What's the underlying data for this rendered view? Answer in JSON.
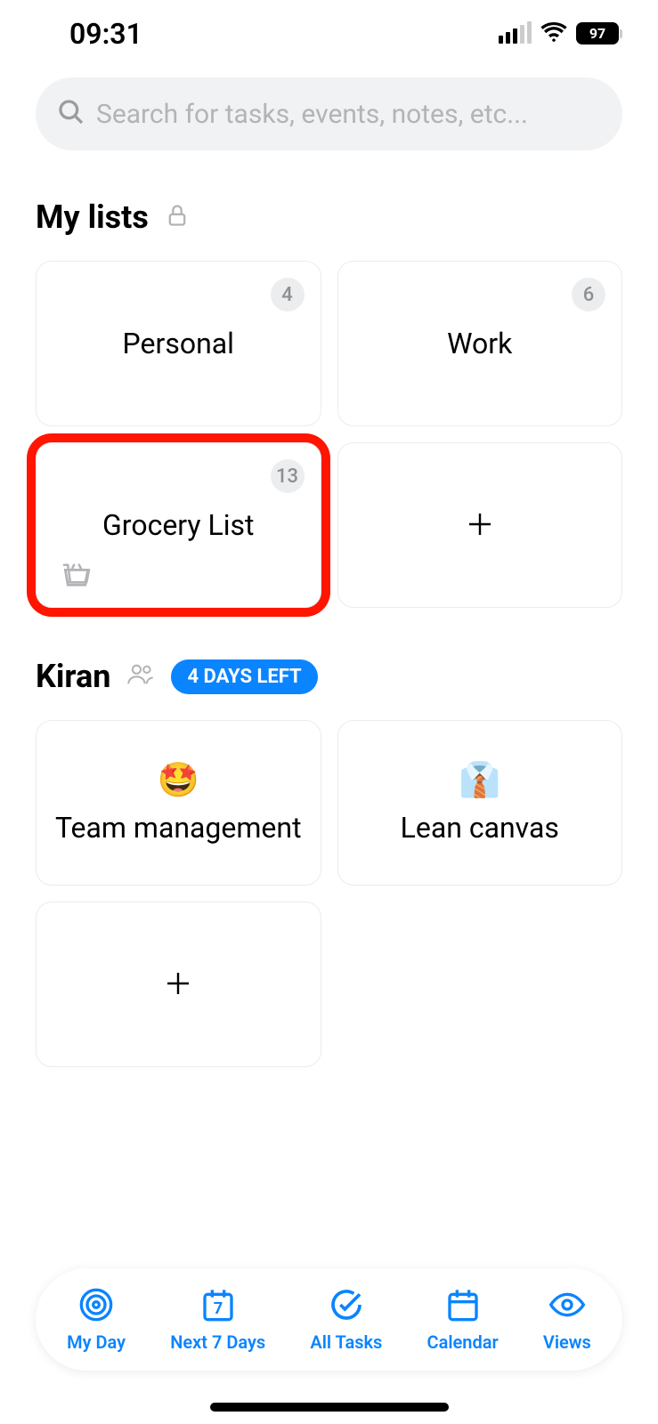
{
  "statusBar": {
    "time": "09:31",
    "battery": "97"
  },
  "search": {
    "placeholder": "Search for tasks, events, notes, etc..."
  },
  "sections": {
    "myLists": {
      "title": "My lists"
    },
    "kiran": {
      "title": "Kiran",
      "badge": "4 DAYS LEFT"
    }
  },
  "myLists": {
    "personal": {
      "title": "Personal",
      "count": "4"
    },
    "work": {
      "title": "Work",
      "count": "6"
    },
    "grocery": {
      "title": "Grocery List",
      "count": "13"
    }
  },
  "kiranLists": {
    "team": {
      "title": "Team management",
      "emoji": "🤩"
    },
    "lean": {
      "title": "Lean canvas",
      "emoji": "👔"
    }
  },
  "bottomNav": {
    "myDay": "My Day",
    "next7": "Next 7 Days",
    "allTasks": "All Tasks",
    "calendar": "Calendar",
    "views": "Views"
  }
}
